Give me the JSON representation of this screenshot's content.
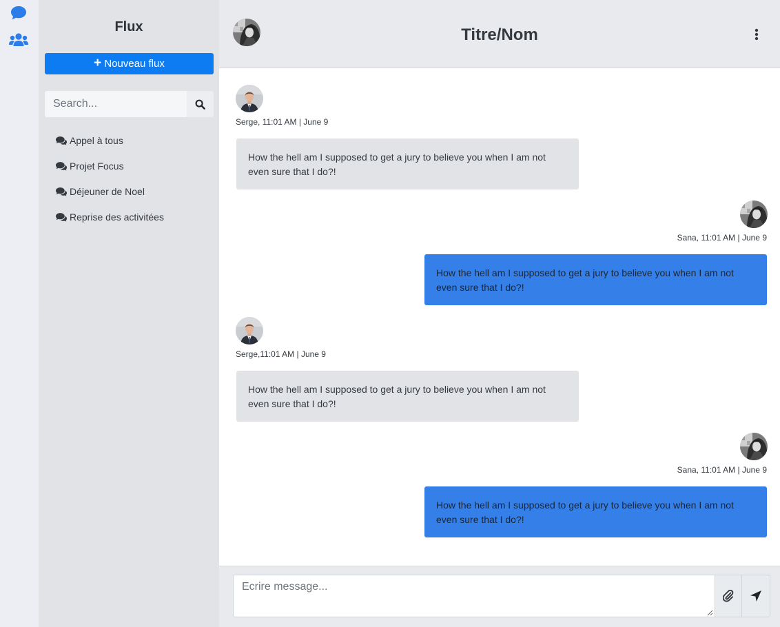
{
  "colors": {
    "accent": "#0d7cf2",
    "outgoing_bubble": "#347fe8",
    "incoming_bubble": "#e2e3e7",
    "rail_icon": "#2b7de9"
  },
  "rail": {
    "icons": [
      "comment-icon",
      "users-icon"
    ]
  },
  "sidebar": {
    "title": "Flux",
    "new_button": "Nouveau flux",
    "search_placeholder": "Search...",
    "items": [
      {
        "label": "Appel à tous"
      },
      {
        "label": "Projet Focus"
      },
      {
        "label": "Déjeuner de Noel"
      },
      {
        "label": "Reprise des activitées"
      }
    ]
  },
  "chat": {
    "title": "Titre/Nom",
    "messages": [
      {
        "direction": "incoming",
        "meta": "Serge, 11:01 AM | June 9",
        "text": "How the hell am I supposed to get a jury to believe you when I am not even sure that I do?!"
      },
      {
        "direction": "outgoing",
        "meta": "Sana, 11:01 AM | June 9",
        "text": "How the hell am I supposed to get a jury to believe you when I am not even sure that I do?!"
      },
      {
        "direction": "incoming",
        "meta": "Serge,11:01 AM | June 9",
        "text": "How the hell am I supposed to get a jury to believe you when I am not even sure that I do?!"
      },
      {
        "direction": "outgoing",
        "meta": "Sana, 11:01 AM | June 9",
        "text": "How the hell am I supposed to get a jury to believe you when I am not even sure that I do?!"
      }
    ]
  },
  "composer": {
    "placeholder": "Ecrire message..."
  }
}
